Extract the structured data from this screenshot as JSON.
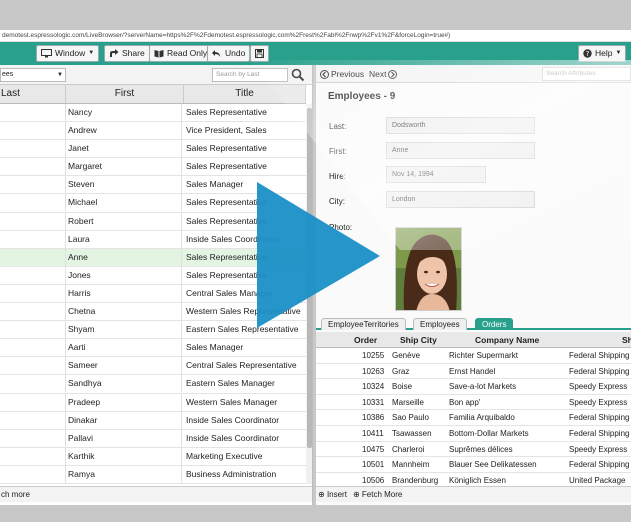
{
  "browser": {
    "url": "demotest.espressologic.com/LiveBrowser/?serverName=https%2F%2Fdemotest.espressologic.com%2Frest%2Fabl%2Fnwp%2Fv1%2F&forceLogin=true#)"
  },
  "toolbar": {
    "window_label": "Window",
    "share_label": "Share",
    "readonly_label": "Read Only",
    "undo_label": "Undo",
    "help_label": "Help"
  },
  "list": {
    "filter_value": "ees",
    "search_placeholder": "Search by Last",
    "columns": [
      "Last",
      "First",
      "Title"
    ],
    "rows": [
      {
        "first": "Nancy",
        "title": "Sales Representative"
      },
      {
        "first": "Andrew",
        "title": "Vice President, Sales"
      },
      {
        "first": "Janet",
        "title": "Sales Representative"
      },
      {
        "first": "Margaret",
        "title": "Sales Representative"
      },
      {
        "first": "Steven",
        "title": "Sales Manager"
      },
      {
        "first": "Michael",
        "title": "Sales Representative"
      },
      {
        "first": "Robert",
        "title": "Sales Representative"
      },
      {
        "first": "Laura",
        "title": "Inside Sales Coordinator"
      },
      {
        "first": "Anne",
        "title": "Sales Representative"
      },
      {
        "first": "Jones",
        "title": "Sales Representative"
      },
      {
        "first": "Harris",
        "title": "Central Sales Manager"
      },
      {
        "first": "Chetna",
        "title": "Western Sales Representative"
      },
      {
        "first": "Shyam",
        "title": "Eastern Sales Representative"
      },
      {
        "first": "Aarti",
        "title": "Sales Manager"
      },
      {
        "first": "Sameer",
        "title": "Central Sales Representative"
      },
      {
        "first": "Sandhya",
        "title": "Eastern Sales Manager"
      },
      {
        "first": "Pradeep",
        "title": "Western Sales Manager"
      },
      {
        "first": "Dinakar",
        "title": "Inside Sales Coordinator"
      },
      {
        "first": "Pallavi",
        "title": "Inside Sales Coordinator"
      },
      {
        "first": "Karthik",
        "title": "Marketing Executive"
      },
      {
        "first": "Ramya",
        "title": "Business Administration"
      }
    ],
    "selected_index": 8,
    "footer_label": "ch more"
  },
  "detail": {
    "previous_label": "Previous",
    "next_label": "Next",
    "attr_search_placeholder": "Search Attributes",
    "title": "Employees - 9",
    "fields": {
      "last_label": "Last:",
      "last_value": "Dodsworth",
      "first_label": "First:",
      "first_value": "Anne",
      "hire_label": "Hire:",
      "hire_value": "Nov 14, 1994",
      "city_label": "City:",
      "city_value": "London",
      "photo_label": "Photo:"
    },
    "tabs": [
      "EmployeeTerritories",
      "Employees",
      "Orders"
    ],
    "active_tab": "Orders",
    "orders_columns": [
      "Order",
      "Ship City",
      "Company Name",
      "Sh"
    ],
    "orders": [
      {
        "order": "10255",
        "city": "Genève",
        "company": "Richter Supermarkt",
        "shipper": "Federal Shipping"
      },
      {
        "order": "10263",
        "city": "Graz",
        "company": "Ernst Handel",
        "shipper": "Federal Shipping"
      },
      {
        "order": "10324",
        "city": "Boise",
        "company": "Save-a-lot Markets",
        "shipper": "Speedy Express"
      },
      {
        "order": "10331",
        "city": "Marseille",
        "company": "Bon app'",
        "shipper": "Speedy Express"
      },
      {
        "order": "10386",
        "city": "Sao Paulo",
        "company": "Familia Arquibaldo",
        "shipper": "Federal Shipping"
      },
      {
        "order": "10411",
        "city": "Tsawassen",
        "company": "Bottom-Dollar Markets",
        "shipper": "Federal Shipping"
      },
      {
        "order": "10475",
        "city": "Charleroi",
        "company": "Suprêmes délices",
        "shipper": "Speedy Express"
      },
      {
        "order": "10501",
        "city": "Mannheim",
        "company": "Blauer See Delikatessen",
        "shipper": "Federal Shipping"
      },
      {
        "order": "10506",
        "city": "Brandenburg",
        "company": "Königlich Essen",
        "shipper": "United Package"
      }
    ],
    "insert_label": "Insert",
    "fetch_more_label": "Fetch More"
  },
  "colors": {
    "accent": "#29a08c",
    "play_button": "#1a8fc6"
  },
  "icons": [
    "monitor-icon",
    "share-icon",
    "book-icon",
    "undo-icon",
    "save-icon",
    "help-icon",
    "search-icon",
    "previous-icon",
    "next-icon",
    "insert-icon",
    "fetch-icon",
    "play-icon"
  ]
}
